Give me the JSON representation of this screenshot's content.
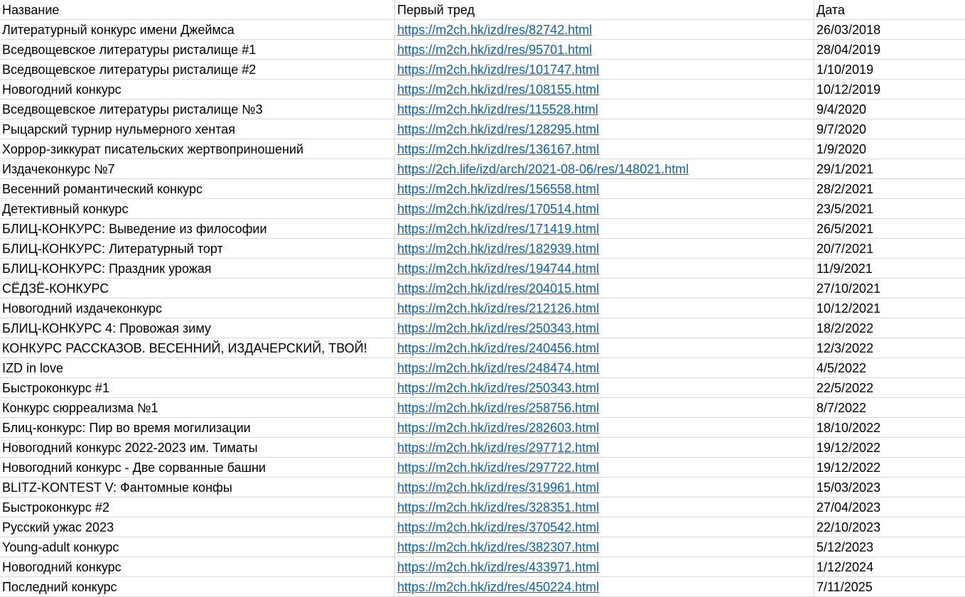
{
  "headers": {
    "name": "Название",
    "thread": "Первый тред",
    "date": "Дата"
  },
  "colors": {
    "link": "#0563c1",
    "gridline": "#d9d9d9"
  },
  "rows": [
    {
      "name": "Литературный конкурс имени Джеймса",
      "thread": "https://m2ch.hk/izd/res/82742.html",
      "date": "26/03/2018"
    },
    {
      "name": "Вседвощевское литературы ристалище #1",
      "thread": "https://m2ch.hk/izd/res/95701.html",
      "date": "28/04/2019"
    },
    {
      "name": "Вседвощевское литературы ристалище #2",
      "thread": "https://m2ch.hk/izd/res/101747.html",
      "date": "1/10/2019"
    },
    {
      "name": "Новогодний конкурс",
      "thread": "https://m2ch.hk/izd/res/108155.html",
      "date": "10/12/2019"
    },
    {
      "name": "Вседвощевское литературы ристалище №3",
      "thread": "https://m2ch.hk/izd/res/115528.html",
      "date": "9/4/2020"
    },
    {
      "name": "Рыцарский турнир нульмерного хентая",
      "thread": "https://m2ch.hk/izd/res/128295.html",
      "date": "9/7/2020"
    },
    {
      "name": "Хоррор-зиккурат писательских жертвоприношений",
      "thread": "https://m2ch.hk/izd/res/136167.html",
      "date": "1/9/2020"
    },
    {
      "name": "Издачеконкурс №7",
      "thread": "https://2ch.life/izd/arch/2021-08-06/res/148021.html",
      "date": "29/1/2021"
    },
    {
      "name": "Весенний романтический конкурс",
      "thread": "https://m2ch.hk/izd/res/156558.html",
      "date": "28/2/2021"
    },
    {
      "name": "Детективный конкурс",
      "thread": "https://m2ch.hk/izd/res/170514.html",
      "date": "23/5/2021"
    },
    {
      "name": "БЛИЦ-КОНКУРС: Выведение из философии",
      "thread": "https://m2ch.hk/izd/res/171419.html",
      "date": "26/5/2021"
    },
    {
      "name": "БЛИЦ-КОНКУРС: Литературный торт",
      "thread": "https://m2ch.hk/izd/res/182939.html",
      "date": "20/7/2021"
    },
    {
      "name": "БЛИЦ-КОНКУРС: Праздник урожая",
      "thread": "https://m2ch.hk/izd/res/194744.html",
      "date": "11/9/2021"
    },
    {
      "name": "СЁДЗЁ-КОНКУРС",
      "thread": "https://m2ch.hk/izd/res/204015.html",
      "date": "27/10/2021"
    },
    {
      "name": "Новогодний издачеконкурс",
      "thread": "https://m2ch.hk/izd/res/212126.html",
      "date": "10/12/2021"
    },
    {
      "name": "БЛИЦ-КОНКУРС 4: Провожая зиму",
      "thread": "https://m2ch.hk/izd/res/250343.html",
      "date": "18/2/2022"
    },
    {
      "name": "КОНКУРС РАССКАЗОВ. ВЕСЕННИЙ, ИЗДАЧЕРСКИЙ, ТВОЙ!",
      "thread": "https://m2ch.hk/izd/res/240456.html",
      "date": "12/3/2022"
    },
    {
      "name": "IZD in love",
      "thread": "https://m2ch.hk/izd/res/248474.html",
      "date": "4/5/2022"
    },
    {
      "name": "Быстроконкурс #1",
      "thread": "https://m2ch.hk/izd/res/250343.html",
      "date": "22/5/2022"
    },
    {
      "name": "Конкурс сюрреализма №1",
      "thread": "https://m2ch.hk/izd/res/258756.html",
      "date": "8/7/2022"
    },
    {
      "name": "Блиц-конкурс: Пир во время могилизации",
      "thread": "https://m2ch.hk/izd/res/282603.html",
      "date": "18/10/2022"
    },
    {
      "name": "Новогодний конкурс 2022-2023 им. Тиматы",
      "thread": "https://m2ch.hk/izd/res/297712.html",
      "date": "19/12/2022"
    },
    {
      "name": "Новогодний конкурс - Две сорванные башни",
      "thread": "https://m2ch.hk/izd/res/297722.html",
      "date": "19/12/2022"
    },
    {
      "name": "BLITZ-KONTEST V: Фантомные конфы",
      "thread": "https://m2ch.hk/izd/res/319961.html",
      "date": "15/03/2023"
    },
    {
      "name": "Быстроконкурс #2",
      "thread": "https://m2ch.hk/izd/res/328351.html",
      "date": "27/04/2023"
    },
    {
      "name": "Русский ужас 2023",
      "thread": "https://m2ch.hk/izd/res/370542.html",
      "date": "22/10/2023"
    },
    {
      "name": "Young-adult конкурс",
      "thread": "https://m2ch.hk/izd/res/382307.html",
      "date": "5/12/2023"
    },
    {
      "name": "Новогодний конкурс",
      "thread": "https://m2ch.hk/izd/res/433971.html",
      "date": "1/12/2024"
    },
    {
      "name": "Последний конкурс",
      "thread": "https://m2ch.hk/izd/res/450224.html",
      "date": "7/11/2025"
    }
  ]
}
